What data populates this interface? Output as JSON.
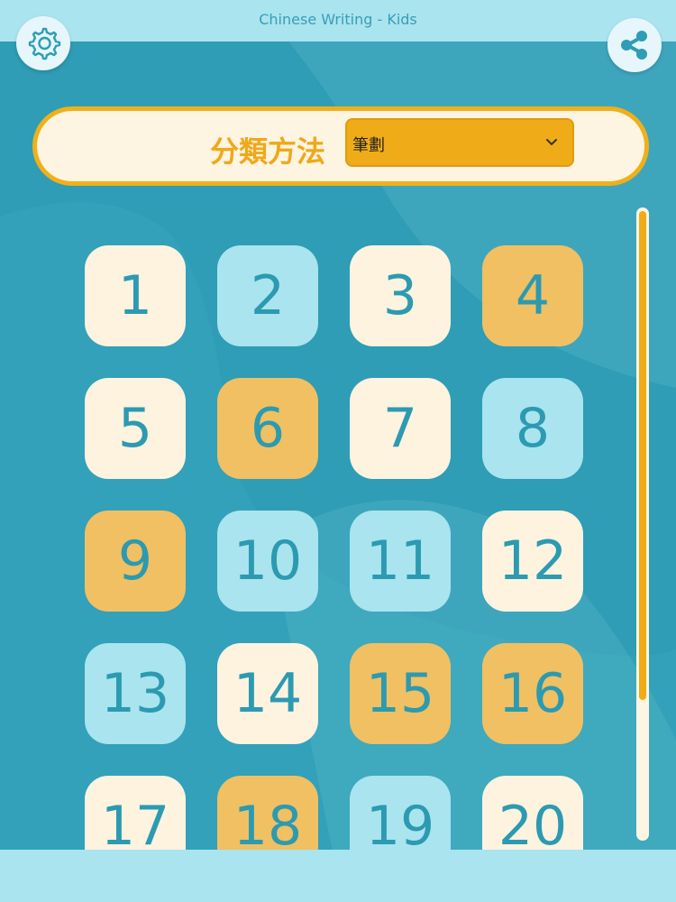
{
  "app_title": "Chinese Writing - Kids",
  "header": {
    "settings_icon": "gear-icon",
    "share_icon": "share-icon"
  },
  "sort": {
    "label": "分類方法",
    "selected": "筆劃",
    "chevron_icon": "chevron-down-icon"
  },
  "colors": {
    "background": "#2e9db5",
    "accent": "#f0ac18",
    "tile_cream": "#fdf3df",
    "tile_blue": "#a9e4ef",
    "tile_gold": "#f0c063",
    "number_text": "#2c9ab1"
  },
  "tiles": [
    {
      "label": "1",
      "style": "cream"
    },
    {
      "label": "2",
      "style": "blue"
    },
    {
      "label": "3",
      "style": "cream"
    },
    {
      "label": "4",
      "style": "gold"
    },
    {
      "label": "5",
      "style": "cream"
    },
    {
      "label": "6",
      "style": "gold"
    },
    {
      "label": "7",
      "style": "cream"
    },
    {
      "label": "8",
      "style": "blue"
    },
    {
      "label": "9",
      "style": "gold"
    },
    {
      "label": "10",
      "style": "blue"
    },
    {
      "label": "11",
      "style": "blue"
    },
    {
      "label": "12",
      "style": "cream"
    },
    {
      "label": "13",
      "style": "blue"
    },
    {
      "label": "14",
      "style": "cream"
    },
    {
      "label": "15",
      "style": "gold"
    },
    {
      "label": "16",
      "style": "gold"
    },
    {
      "label": "17",
      "style": "cream"
    },
    {
      "label": "18",
      "style": "gold"
    },
    {
      "label": "19",
      "style": "blue"
    },
    {
      "label": "20",
      "style": "cream"
    }
  ]
}
